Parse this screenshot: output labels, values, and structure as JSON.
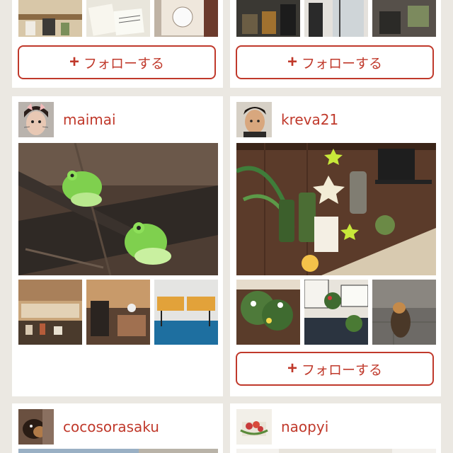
{
  "colors": {
    "background": "#ebe8e2",
    "card": "#ffffff",
    "accent": "#c0392b"
  },
  "follow_label": "フォローする",
  "cards": [
    {
      "username": "",
      "follow_label": "フォローする"
    },
    {
      "username": "",
      "follow_label": "フォローする"
    },
    {
      "username": "maimai"
    },
    {
      "username": "kreva21",
      "follow_label": "フォローする"
    },
    {
      "username": "cocosorasaku"
    },
    {
      "username": "naopyi"
    }
  ]
}
